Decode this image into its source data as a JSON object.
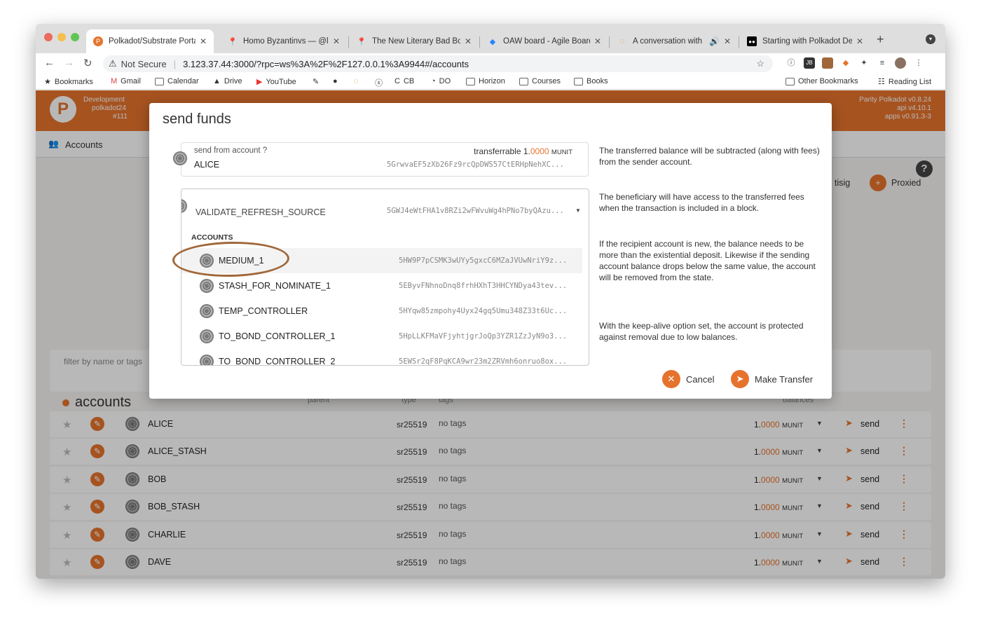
{
  "browser": {
    "tabs": [
      {
        "title": "Polkadot/Substrate Portal",
        "icon": "polkadot-icon",
        "active": true
      },
      {
        "title": "Homo Byzantinvs — @lm",
        "icon": "pin-icon"
      },
      {
        "title": "The New Literary Bad Bo",
        "icon": "pin-icon"
      },
      {
        "title": "OAW board - Agile Board",
        "icon": "jira-icon"
      },
      {
        "title": "A conversation with",
        "icon": "loading-icon"
      },
      {
        "title": "Starting with Polkadot De",
        "icon": "medium-icon"
      }
    ],
    "address": {
      "security": "Not Secure",
      "url": "3.123.37.44:3000/?rpc=ws%3A%2F%2F127.0.0.1%3A9944#/accounts"
    },
    "bookmarks": [
      "Bookmarks",
      "Gmail",
      "Calendar",
      "Drive",
      "YouTube",
      "CB",
      "DO",
      "Horizon",
      "Courses",
      "Books"
    ],
    "bookmarks_right": [
      "Other Bookmarks",
      "Reading List"
    ]
  },
  "app": {
    "network": "Development",
    "node": "polkadot24",
    "block": "#111",
    "version_lines": [
      "Parity Polkadot v0.8.24",
      "api v4.10.1",
      "apps v0.91.3-3"
    ],
    "nav": "Accounts",
    "proxied": "Proxied",
    "multisig": "tisig",
    "filter_placeholder": "filter by name or tags",
    "section": "accounts",
    "columns": [
      "parent",
      "type",
      "tags",
      "balances"
    ],
    "rows": [
      {
        "name": "ALICE",
        "type": "sr25519",
        "tags": "no tags",
        "whole": "1.",
        "decimals": "0000",
        "unit": "MUNIT",
        "send": "send"
      },
      {
        "name": "ALICE_STASH",
        "type": "sr25519",
        "tags": "no tags",
        "whole": "1.",
        "decimals": "0000",
        "unit": "MUNIT",
        "send": "send"
      },
      {
        "name": "BOB",
        "type": "sr25519",
        "tags": "no tags",
        "whole": "1.",
        "decimals": "0000",
        "unit": "MUNIT",
        "send": "send"
      },
      {
        "name": "BOB_STASH",
        "type": "sr25519",
        "tags": "no tags",
        "whole": "1.",
        "decimals": "0000",
        "unit": "MUNIT",
        "send": "send"
      },
      {
        "name": "CHARLIE",
        "type": "sr25519",
        "tags": "no tags",
        "whole": "1.",
        "decimals": "0000",
        "unit": "MUNIT",
        "send": "send"
      },
      {
        "name": "DAVE",
        "type": "sr25519",
        "tags": "no tags",
        "whole": "1.",
        "decimals": "0000",
        "unit": "MUNIT",
        "send": "send"
      }
    ]
  },
  "modal": {
    "title": "send funds",
    "from_label": "send from account",
    "from_name": "ALICE",
    "from_address": "5GrwvaEF5zXb26Fz9rcQpDWS57CtERHpNehXC...",
    "transferrable_label": "transferrable",
    "transferrable_whole": "1.",
    "transferrable_decimals": "0000",
    "transferrable_unit": "MUNIT",
    "to_name": "VALIDATE_REFRESH_SOURCE",
    "to_address": "5GWJ4eWtFHA1v8RZi2wFWvuWg4hPNo7byQAzu...",
    "group_header": "ACCOUNTS",
    "options": [
      {
        "name": "MEDIUM_1",
        "address": "5HW9P7pCSMK3wUYy5gxcC6MZaJVUwNriY9z..."
      },
      {
        "name": "STASH_FOR_NOMINATE_1",
        "address": "5EByvFNhnoDnq8frhHXhT3HHCYNDya43tev..."
      },
      {
        "name": "TEMP_CONTROLLER",
        "address": "5HYqw85zmpohy4Uyx24gq5Umu348Z33t6Uc..."
      },
      {
        "name": "TO_BOND_CONTROLLER_1",
        "address": "5HpLLKFMaVFjyhtjgrJoQp3YZR1ZzJyN9o3..."
      },
      {
        "name": "TO_BOND_CONTROLLER_2",
        "address": "5EWSr2qF8PqKCA9wr23m2ZRVmh6onruo8ox..."
      }
    ],
    "help": [
      "The transferred balance will be subtracted (along with fees) from the sender account.",
      "The beneficiary will have access to the transferred fees when the transaction is included in a block.",
      "If the recipient account is new, the balance needs to be more than the existential deposit. Likewise if the sending account balance drops below the same value, the account will be removed from the state.",
      "With the keep-alive option set, the account is protected against removal due to low balances."
    ],
    "cancel": "Cancel",
    "submit": "Make Transfer"
  },
  "colors": {
    "accent": "#e6732d",
    "annotation": "#a0683a"
  }
}
